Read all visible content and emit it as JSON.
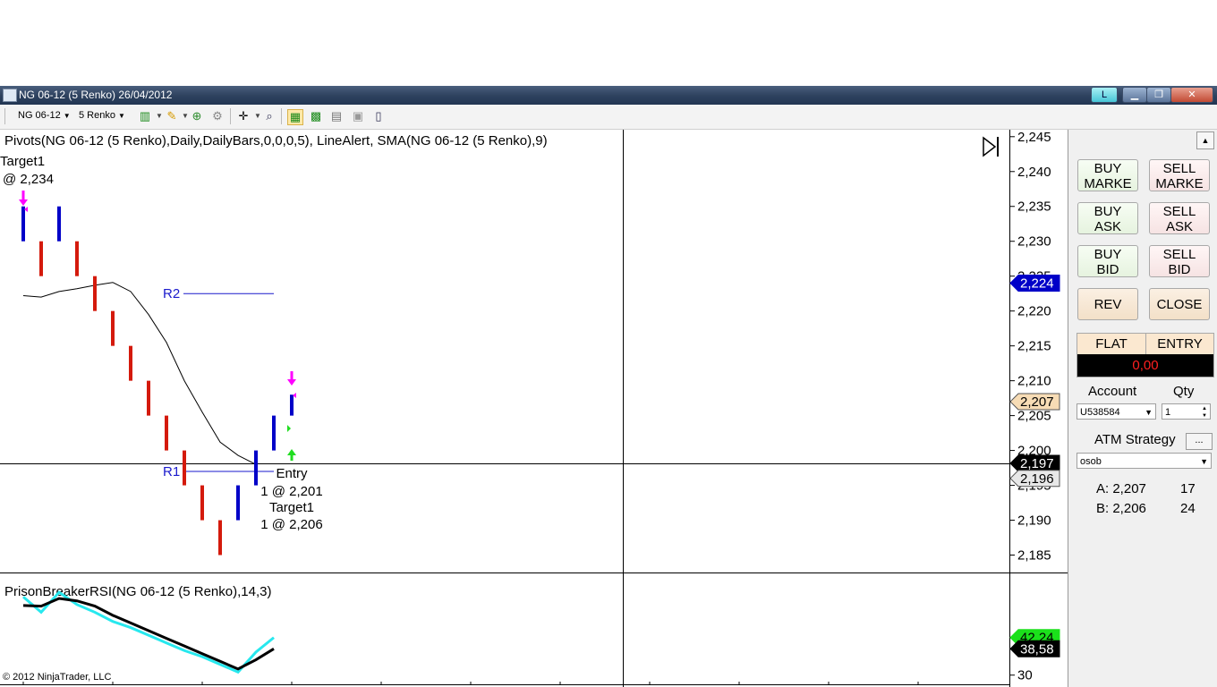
{
  "window": {
    "title": "NG 06-12 (5 Renko)  26/04/2012",
    "buttons": {
      "l": "L",
      "min": "▁",
      "max": "❐",
      "close": "✕"
    }
  },
  "toolbar": {
    "instrument": "NG 06-12",
    "period": "5 Renko",
    "icons": [
      "bar-style-icon",
      "pencil-draw-icon",
      "add-indicator-icon",
      "strategy-icon",
      "crosshair-icon",
      "zoom-icon",
      "chart-trader-icon",
      "data-box-icon",
      "chart-properties-icon",
      "export-icon",
      "templates-icon"
    ]
  },
  "chart": {
    "indicator_label": "Pivots(NG 06-12 (5 Renko),Daily,DailyBars,0,0,0,5), LineAlert, SMA(NG 06-12 (5 Renko),9)",
    "annotations": {
      "target_top_1": "Target1",
      "target_top_2": "@ 2,234",
      "entry_1": "Entry",
      "entry_2": "1 @ 2,201",
      "target_bot_1": "Target1",
      "target_bot_2": "1 @ 2,206"
    },
    "pivots": {
      "r2": "R2",
      "r1": "R1"
    },
    "price_axis": [
      "2,245",
      "2,240",
      "2,235",
      "2,230",
      "2,225",
      "2,220",
      "2,215",
      "2,210",
      "2,205",
      "2,200",
      "2,195",
      "2,190",
      "2,185"
    ],
    "price_tags": [
      {
        "label": "2,224",
        "bg": "#0000c8",
        "fg": "#ffffff"
      },
      {
        "label": "2,207",
        "bg": "#f7dcb5",
        "fg": "#000000"
      },
      {
        "label": "2,197",
        "bg": "#000000",
        "fg": "#ffffff"
      },
      {
        "label": "2,196",
        "bg": "#e8e8e8",
        "fg": "#000000"
      }
    ],
    "colors": {
      "up": "#0000c8",
      "down": "#d41a0c",
      "sma": "#000000",
      "rsi": "#000000",
      "rsi_signal": "#27e8ee"
    }
  },
  "chart_data": {
    "type": "candlestick",
    "series": [
      {
        "name": "bars",
        "values": [
          {
            "o": 2.23,
            "c": 2.235
          },
          {
            "o": 2.23,
            "c": 2.225
          },
          {
            "o": 2.23,
            "c": 2.235
          },
          {
            "o": 2.23,
            "c": 2.225
          },
          {
            "o": 2.225,
            "c": 2.22
          },
          {
            "o": 2.22,
            "c": 2.215
          },
          {
            "o": 2.215,
            "c": 2.21
          },
          {
            "o": 2.21,
            "c": 2.205
          },
          {
            "o": 2.205,
            "c": 2.2
          },
          {
            "o": 2.2,
            "c": 2.195
          },
          {
            "o": 2.195,
            "c": 2.19
          },
          {
            "o": 2.19,
            "c": 2.185
          },
          {
            "o": 2.19,
            "c": 2.195
          },
          {
            "o": 2.195,
            "c": 2.2
          },
          {
            "o": 2.2,
            "c": 2.205
          },
          {
            "o": 2.205,
            "c": 2.208
          }
        ]
      },
      {
        "name": "sma",
        "values": [
          2.2222,
          2.222,
          2.2228,
          2.2232,
          2.2237,
          2.2241,
          2.2228,
          2.2195,
          2.2155,
          2.21,
          2.2055,
          2.2012,
          2.1993,
          2.198
        ]
      }
    ],
    "pivot_levels": {
      "R2": 2.2225,
      "R1": 2.197
    },
    "ylim": [
      2.1825,
      2.246
    ],
    "rsi_panel": {
      "label": "PrisonBreakerRSI(NG 06-12 (5 Renko),14,3)",
      "axis": [
        "30"
      ],
      "tags": [
        {
          "label": "42,24",
          "bg": "#1be01b",
          "fg": "#000000"
        },
        {
          "label": "38,58",
          "bg": "#000000",
          "fg": "#ffffff"
        }
      ],
      "rsi": [
        52.7,
        52.5,
        55.0,
        54.2,
        52.5,
        49.5,
        47.0,
        44.5,
        42.0,
        39.5,
        37.0,
        34.5,
        32.0,
        35.0,
        38.58
      ],
      "signal": [
        55.5,
        50.5,
        57.0,
        53.0,
        50.5,
        47.5,
        45.5,
        43.0,
        40.5,
        38.0,
        36.0,
        33.5,
        31.0,
        37.5,
        42.24
      ],
      "ylim": [
        27,
        62
      ]
    }
  },
  "panel": {
    "buy_market": [
      "BUY",
      "MARKE"
    ],
    "sell_market": [
      "SELL",
      "MARKE"
    ],
    "buy_ask": [
      "BUY",
      "ASK"
    ],
    "sell_ask": [
      "SELL",
      "ASK"
    ],
    "buy_bid": [
      "BUY",
      "BID"
    ],
    "sell_bid": [
      "SELL",
      "BID"
    ],
    "rev": "REV",
    "close": "CLOSE",
    "position": "FLAT",
    "entry": "ENTRY",
    "pnl": "0,00",
    "account_label": "Account",
    "qty_label": "Qty",
    "account_value": "U538584",
    "qty_value": "1",
    "atm_label": "ATM Strategy",
    "atm_button": "...",
    "atm_value": "osob",
    "ask_label": "A: 2,207",
    "ask_size": "17",
    "bid_label": "B: 2,206",
    "bid_size": "24"
  },
  "footer": {
    "copyright": "© 2012 NinjaTrader, LLC"
  }
}
